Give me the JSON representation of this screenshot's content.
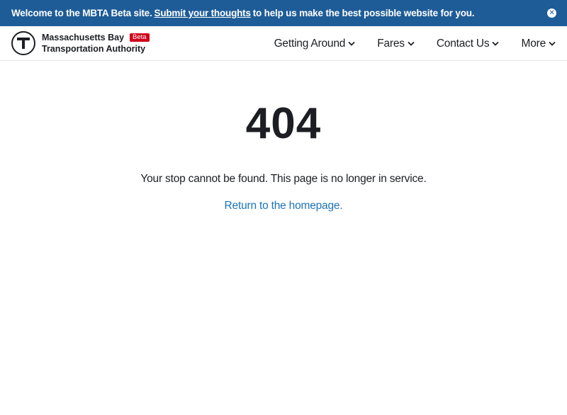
{
  "banner": {
    "text_before": "Welcome to the MBTA Beta site.",
    "link_text": "Submit your thoughts",
    "text_after": "to help us make the best possible website for you.",
    "close_icon": "close-circle-icon",
    "colors": {
      "background": "#1e5c97",
      "text": "#ffffff"
    }
  },
  "header": {
    "logo_icon": "mbta-t-icon",
    "brand_line1": "Massachusetts Bay",
    "brand_line2": "Transportation Authority",
    "beta_label": "Beta",
    "nav": [
      {
        "label": "Getting Around",
        "icon": "chevron-down-icon"
      },
      {
        "label": "Fares",
        "icon": "chevron-down-icon"
      },
      {
        "label": "Contact Us",
        "icon": "chevron-down-icon"
      },
      {
        "label": "More",
        "icon": "chevron-down-icon"
      }
    ]
  },
  "main": {
    "error_code": "404",
    "message": "Your stop cannot be found. This page is no longer in service.",
    "home_link": "Return to the homepage."
  },
  "colors": {
    "accent": "#1c74bb",
    "beta": "#d0021b",
    "text": "#1c1e23"
  }
}
